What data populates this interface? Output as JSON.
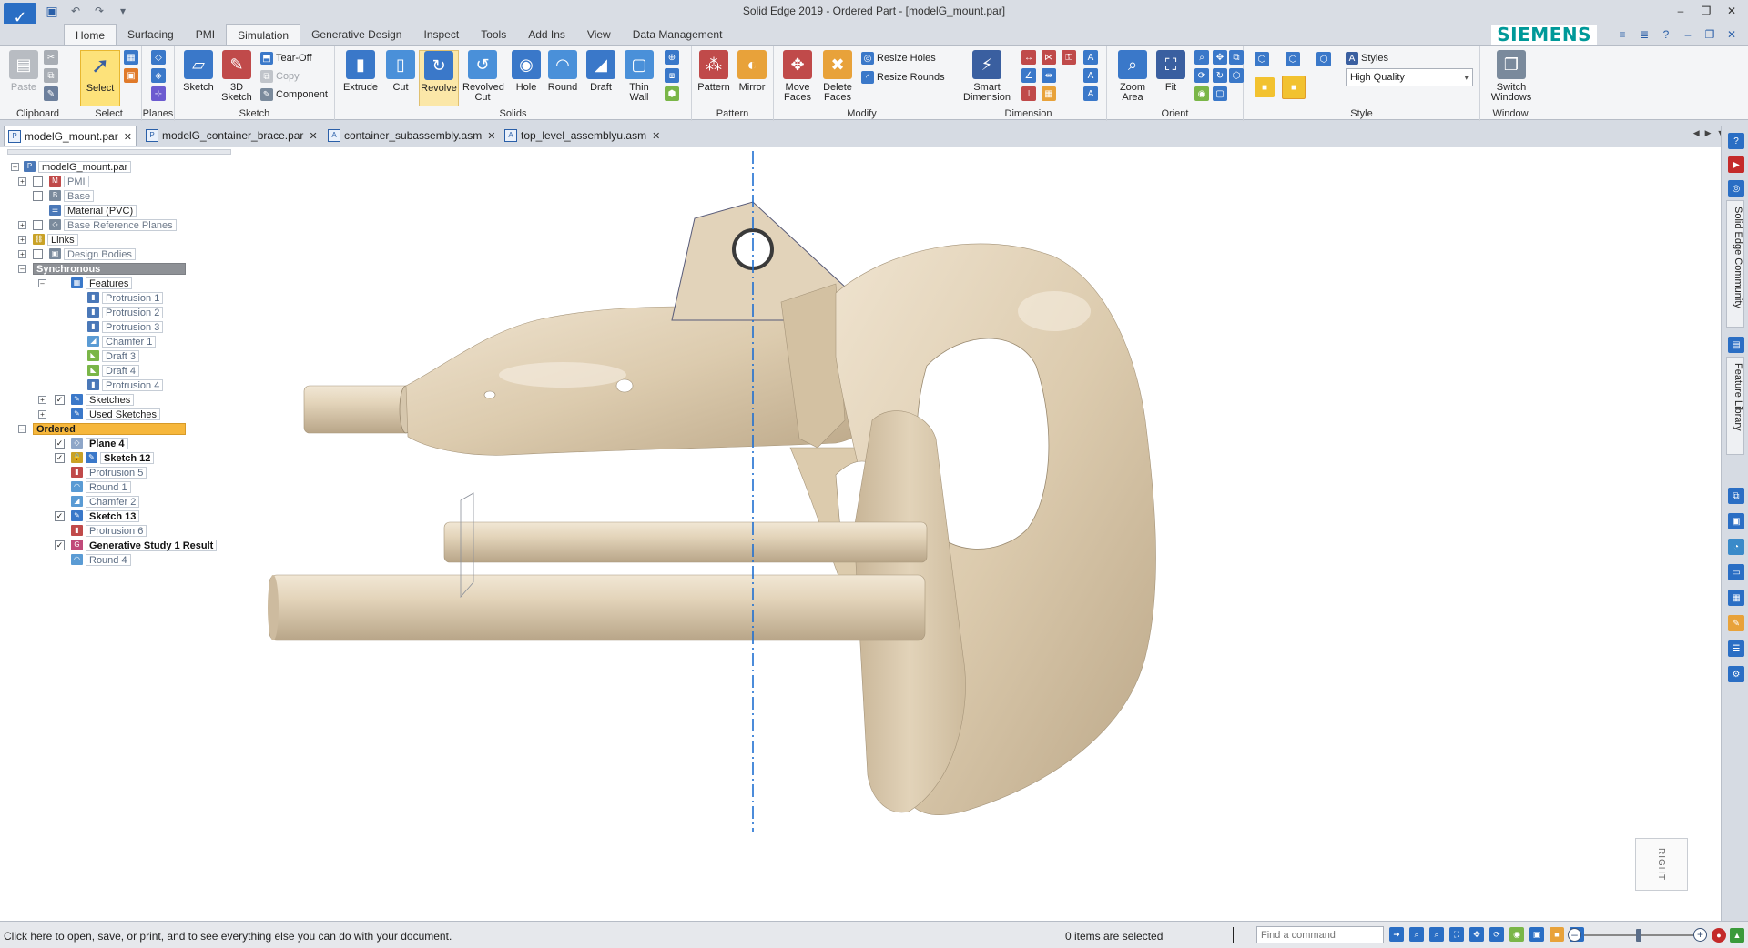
{
  "window": {
    "title": "Solid Edge 2019 - Ordered Part - [modelG_mount.par]",
    "brand": "SIEMENS"
  },
  "ribbon_tabs": [
    "Home",
    "Surfacing",
    "PMI",
    "Simulation",
    "Generative Design",
    "Inspect",
    "Tools",
    "Add Ins",
    "View",
    "Data Management"
  ],
  "ribbon": {
    "groups": {
      "clipboard": "Clipboard",
      "select": "Select",
      "planes": "Planes",
      "sketch": "Sketch",
      "solids": "Solids",
      "pattern": "Pattern",
      "modify": "Modify",
      "dimension": "Dimension",
      "orient": "Orient",
      "style": "Style",
      "window": "Window"
    },
    "buttons": {
      "paste": "Paste",
      "select": "Select",
      "sketch": "Sketch",
      "sketch3d_line1": "3D",
      "sketch3d_line2": "Sketch",
      "tear_off": "Tear-Off",
      "copy": "Copy",
      "component": "Component",
      "extrude": "Extrude",
      "cut": "Cut",
      "revolve": "Revolve",
      "revolved_cut_line1": "Revolved",
      "revolved_cut_line2": "Cut",
      "hole": "Hole",
      "round": "Round",
      "draft": "Draft",
      "thin_wall_line1": "Thin",
      "thin_wall_line2": "Wall",
      "pattern": "Pattern",
      "mirror": "Mirror",
      "move_faces_line1": "Move",
      "move_faces_line2": "Faces",
      "delete_faces_line1": "Delete",
      "delete_faces_line2": "Faces",
      "resize_holes": "Resize Holes",
      "resize_rounds": "Resize Rounds",
      "smart_dimension_line1": "Smart",
      "smart_dimension_line2": "Dimension",
      "zoom_area_line1": "Zoom",
      "zoom_area_line2": "Area",
      "fit": "Fit",
      "styles": "Styles",
      "quality_value": "High Quality",
      "switch_windows_line1": "Switch",
      "switch_windows_line2": "Windows"
    }
  },
  "doc_tabs": [
    "modelG_mount.par",
    "modelG_container_brace.par",
    "container_subassembly.asm",
    "top_level_assemblyu.asm"
  ],
  "tree": {
    "root": "modelG_mount.par",
    "pmi": "PMI",
    "base": "Base",
    "material": "Material (PVC)",
    "base_ref_planes": "Base Reference Planes",
    "links": "Links",
    "design_bodies": "Design Bodies",
    "synchronous": "Synchronous",
    "features": "Features",
    "sync_features": [
      "Protrusion 1",
      "Protrusion 2",
      "Protrusion 3",
      "Chamfer 1",
      "Draft 3",
      "Draft 4",
      "Protrusion 4"
    ],
    "sketches": "Sketches",
    "used_sketches": "Used Sketches",
    "ordered": "Ordered",
    "plane4": "Plane 4",
    "sketch12": "Sketch 12",
    "protrusion5": "Protrusion 5",
    "round1": "Round 1",
    "chamfer2": "Chamfer 2",
    "sketch13": "Sketch 13",
    "protrusion6": "Protrusion 6",
    "gen_study": "Generative Study 1 Result",
    "round4": "Round 4"
  },
  "viewport": {
    "view_cube_label": "RIGHT",
    "model_color": "#d9c9ad"
  },
  "right_dock": {
    "community": "Solid Edge Community",
    "feature_library": "Feature Library"
  },
  "status": {
    "hint": "Click here to open, save, or print, and to see everything else you can do with your document.",
    "selection": "0 items are selected",
    "command_placeholder": "Find a command"
  }
}
